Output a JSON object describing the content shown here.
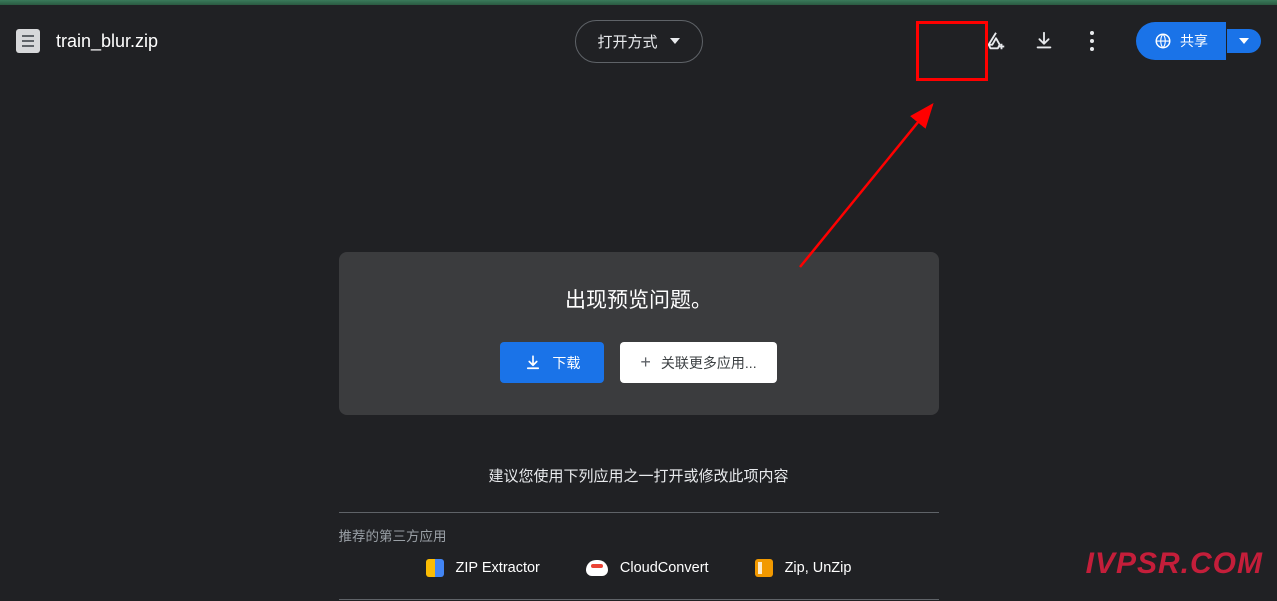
{
  "header": {
    "file_name": "train_blur.zip",
    "open_with_label": "打开方式",
    "share_label": "共享"
  },
  "preview": {
    "title": "出现预览问题。",
    "download_label": "下载",
    "connect_label": "关联更多应用..."
  },
  "suggestion": {
    "text": "建议您使用下列应用之一打开或修改此项内容",
    "third_party_label": "推荐的第三方应用",
    "apps": [
      {
        "name": "ZIP Extractor"
      },
      {
        "name": "CloudConvert"
      },
      {
        "name": "Zip, UnZip"
      }
    ]
  },
  "watermark": "IVPSR.COM"
}
